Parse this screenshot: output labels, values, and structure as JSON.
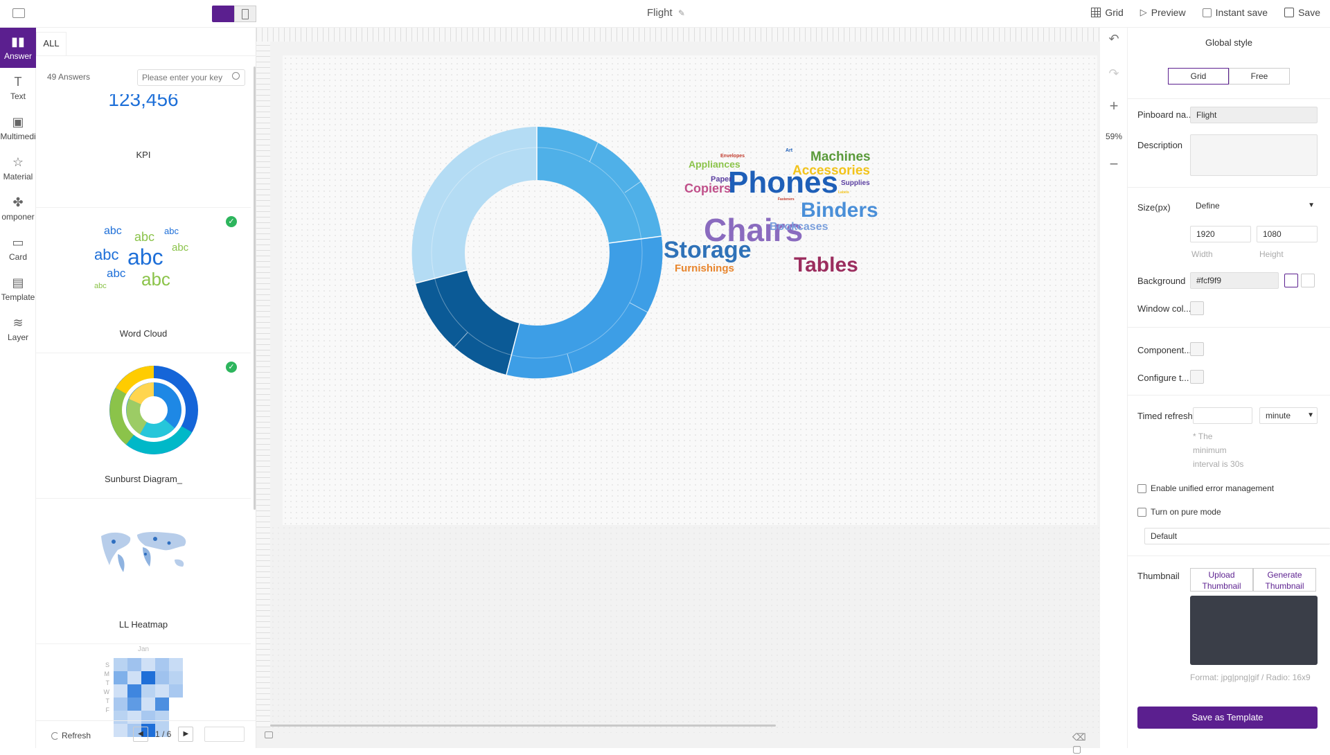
{
  "topbar": {
    "title": "Flight",
    "actions": [
      {
        "label": "Grid",
        "icon": "grid-icon"
      },
      {
        "label": "Preview",
        "icon": "preview-icon"
      },
      {
        "label": "Instant save",
        "icon": "checkbox-icon"
      },
      {
        "label": "Save",
        "icon": "save-icon"
      }
    ]
  },
  "leftnav": [
    {
      "label": "Answer",
      "icon": "bar-chart-icon",
      "active": true
    },
    {
      "label": "Text",
      "icon": "text-icon"
    },
    {
      "label": "Multimedi",
      "icon": "image-icon"
    },
    {
      "label": "Material",
      "icon": "star-icon"
    },
    {
      "label": "omponer",
      "icon": "puzzle-icon"
    },
    {
      "label": "Card",
      "icon": "card-icon"
    },
    {
      "label": "Template",
      "icon": "template-icon"
    },
    {
      "label": "Layer",
      "icon": "layers-icon"
    }
  ],
  "panel": {
    "tab": "ALL",
    "answers_count": "49 Answers",
    "search_placeholder": "Please enter your key",
    "kpi_value": "123,456",
    "cards": [
      "KPI",
      "Word Cloud",
      "Sunburst Diagram_",
      "LL Heatmap"
    ],
    "calendar_month": "Jan",
    "calendar_days": [
      "S",
      "M",
      "T",
      "W",
      "T",
      "F"
    ],
    "refresh": "Refresh",
    "pager": "1 / 6"
  },
  "canvas": {
    "wordcloud_words": [
      {
        "text": "Phones",
        "color": "#1e5fb8"
      },
      {
        "text": "Chairs",
        "color": "#8a6bbf"
      },
      {
        "text": "Storage",
        "color": "#2f72b8"
      },
      {
        "text": "Binders",
        "color": "#4a8fd8"
      },
      {
        "text": "Tables",
        "color": "#9b2d5e"
      },
      {
        "text": "Machines",
        "color": "#5a9a3a"
      },
      {
        "text": "Accessories",
        "color": "#f2c31b"
      },
      {
        "text": "Copiers",
        "color": "#c0508a"
      },
      {
        "text": "Appliances",
        "color": "#8bc34a"
      },
      {
        "text": "Bookcases",
        "color": "#7a9fdc"
      },
      {
        "text": "Furnishings",
        "color": "#e8852c"
      },
      {
        "text": "Paper",
        "color": "#5b3fa0"
      },
      {
        "text": "Supplies",
        "color": "#5b3fa0"
      },
      {
        "text": "Envelopes",
        "color": "#c0392b"
      },
      {
        "text": "Art",
        "color": "#1e5fb8"
      },
      {
        "text": "Fasteners",
        "color": "#c0392b"
      },
      {
        "text": "Labels",
        "color": "#f2c31b"
      }
    ]
  },
  "tools": {
    "zoom": "59%"
  },
  "rpanel": {
    "title": "Global style",
    "layout_grid": "Grid",
    "layout_free": "Free",
    "pinboard_label": "Pinboard na...",
    "pinboard_value": "Flight",
    "description_label": "Description",
    "size_label": "Size(px)",
    "size_mode": "Define",
    "width_value": "1920",
    "height_value": "1080",
    "width_label": "Width",
    "height_label": "Height",
    "background_label": "Background",
    "background_value": "#fcf9f9",
    "window_label": "Window col...",
    "component_label": "Component...",
    "configure_label": "Configure t...",
    "timed_refresh_label": "Timed refresh",
    "timed_unit": "minute",
    "timed_note": "* The minimum interval is 30s",
    "unified_error": "Enable unified error management",
    "pure_mode": "Turn on pure mode",
    "theme": "Default",
    "thumbnail_label": "Thumbnail",
    "upload_thumb": "Upload Thumbnail",
    "generate_thumb": "Generate Thumbnail",
    "format_note": "Format:  jpg|png|gif / Radio: 16x9",
    "save_template": "Save as Template"
  }
}
